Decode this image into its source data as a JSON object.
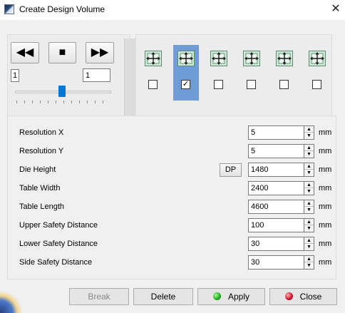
{
  "window": {
    "title": "Create Design Volume",
    "close_glyph": "✕"
  },
  "playback": {
    "rewind_glyph": "◀◀",
    "stop_glyph": "■",
    "forward_glyph": "▶▶",
    "frame_label": "1",
    "frame_value": "1",
    "slider_fraction": 0.5
  },
  "views": [
    {
      "icon": "view-direction-icon",
      "checked": false,
      "check_glyph": ""
    },
    {
      "icon": "view-direction-icon",
      "checked": true,
      "check_glyph": "✓"
    },
    {
      "icon": "view-direction-icon",
      "checked": false,
      "check_glyph": ""
    },
    {
      "icon": "view-direction-icon",
      "checked": false,
      "check_glyph": ""
    },
    {
      "icon": "view-direction-icon",
      "checked": false,
      "check_glyph": ""
    },
    {
      "icon": "view-direction-icon",
      "checked": false,
      "check_glyph": ""
    }
  ],
  "params": [
    {
      "label": "Resolution X",
      "value": "5",
      "unit": "mm"
    },
    {
      "label": "Resolution Y",
      "value": "5",
      "unit": "mm"
    },
    {
      "label": "Die Height",
      "value": "1480",
      "unit": "mm",
      "button": "DP"
    },
    {
      "label": "Table Width",
      "value": "2400",
      "unit": "mm"
    },
    {
      "label": "Table Length",
      "value": "4600",
      "unit": "mm"
    },
    {
      "label": "Upper Safety Distance",
      "value": "100",
      "unit": "mm"
    },
    {
      "label": "Lower Safety Distance",
      "value": "30",
      "unit": "mm"
    },
    {
      "label": "Side Safety Distance",
      "value": "30",
      "unit": "mm"
    }
  ],
  "spin_up_glyph": "▲",
  "spin_down_glyph": "▼",
  "buttons": {
    "break": "Break",
    "delete": "Delete",
    "apply": "Apply",
    "close": "Close"
  },
  "colors": {
    "accent": "#0078d7",
    "active_view": "#6f9cd6",
    "apply_led": "#19a81b",
    "close_led": "#c8102e"
  }
}
